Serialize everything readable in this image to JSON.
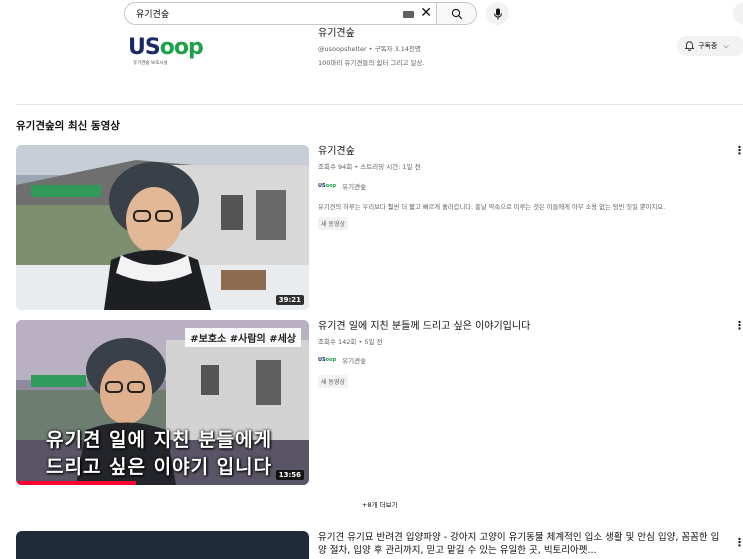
{
  "search": {
    "value": "유기견숲"
  },
  "channel": {
    "logo_us": "US",
    "logo_oop": "oop",
    "logo_sub": "유기견숲 보호시설",
    "name": "유기견숲",
    "meta": "@usoopshelter • 구독자 3.14천명",
    "description": "100마리 유기견들의 쉼터 그리고 일상.",
    "subscribe_label": "구독중"
  },
  "section": {
    "title": "유기견숲의 최신 동영상"
  },
  "videos": [
    {
      "title": "유기견숲",
      "meta": "조회수 94회 • 스트리밍 시간: 1일 전",
      "channel": "유기견숲",
      "description": "유기견의 하루는 우리보다 훨씬 더 짧고 빠르게 흘러갑니다. 홍날 약속으로 미루는 것은 이들에게 아무 소용 없는 텅빈 짓일 뿐이지요.",
      "badge": "새 동영상",
      "duration": "39:21"
    },
    {
      "title": "유기견 일에 지친 분들께 드리고 싶은 이야기입니다",
      "meta": "조회수 142회 • 5일 전",
      "channel": "유기견숲",
      "badge": "새 동영상",
      "duration": "13:56",
      "thumb_tags": "#보호소 #사람의 #세상",
      "thumb_caption_1": "유기견 일에 지친 분들에게",
      "thumb_caption_2": "드리고 싶은 이야기 입니다"
    },
    {
      "title": "유기견 유기묘 반려견 입양파양 - 강아지 고양이 유기동물 체계적인 입소 생활 및 안심 입양, 꼼꼼한 입양 절차, 입양 후 관리까지, 믿고 맡길 수 있는 유일한 곳, 빅토리아펫..."
    }
  ],
  "show_more_label": "+8개 더보기",
  "colors": {
    "brand_dark": "#1a2a66",
    "brand_green": "#1fa04a",
    "meta_grey": "#606060"
  }
}
